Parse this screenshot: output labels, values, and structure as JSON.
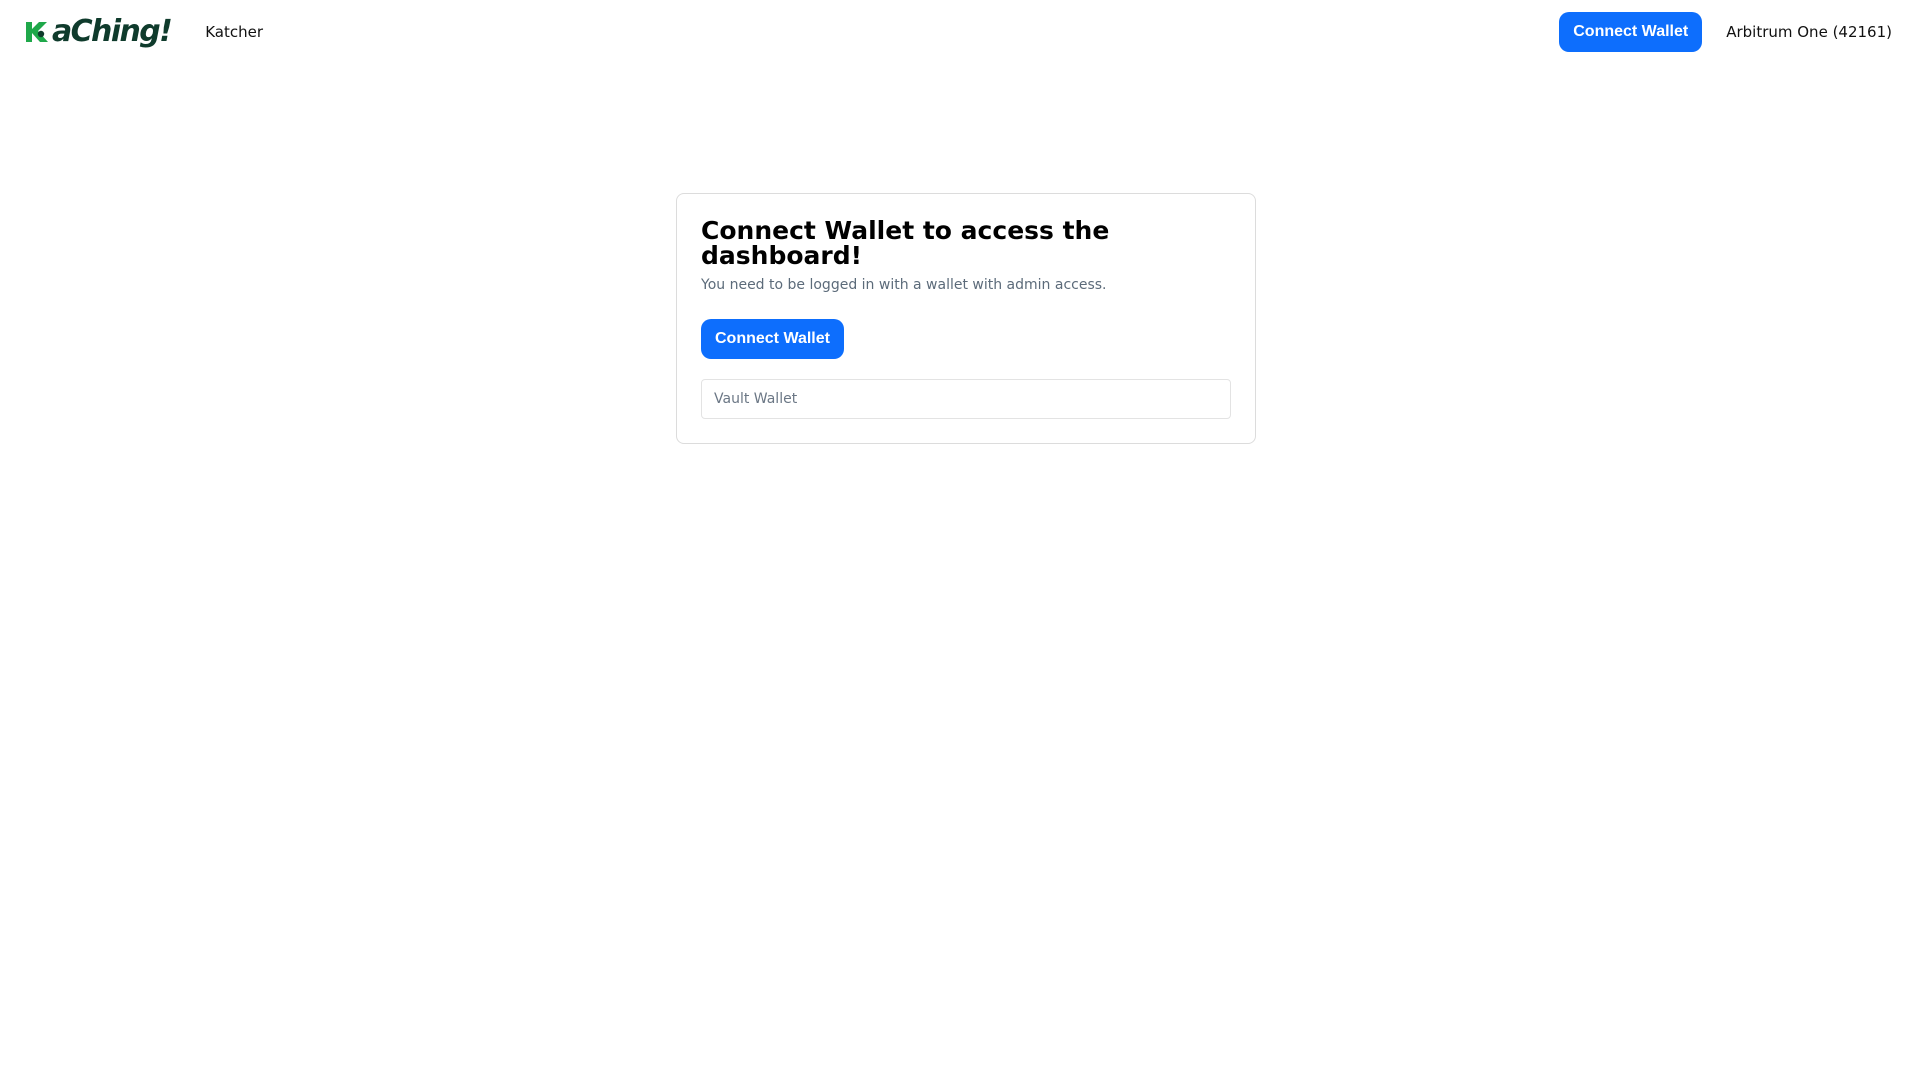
{
  "header": {
    "logo_text": "aChing!",
    "logo_icon": "kaching-k-logo-icon",
    "nav_link": "Katcher",
    "connect_label": "Connect Wallet",
    "network": "Arbitrum One (42161)"
  },
  "card": {
    "title": "Connect Wallet to access the dashboard!",
    "subtitle": "You need to be logged in with a wallet with admin access.",
    "connect_label": "Connect Wallet",
    "vault_placeholder": "Vault Wallet",
    "vault_value": ""
  },
  "colors": {
    "primary": "#0d6efd",
    "brand_green": "#1fa84a",
    "brand_dark": "#0f3b2c",
    "muted_text": "#5c6b7a",
    "border": "#dcdcdc"
  }
}
